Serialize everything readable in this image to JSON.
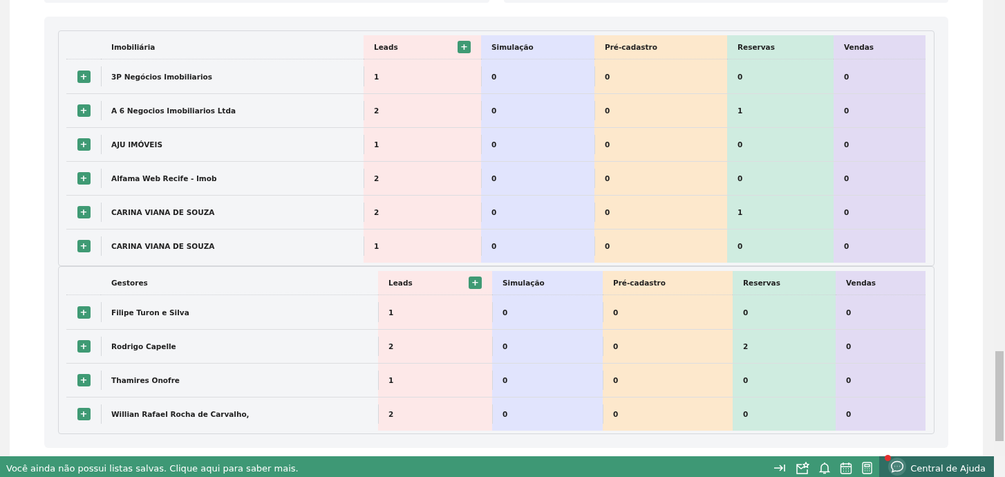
{
  "tables": [
    {
      "columns": [
        {
          "label": "Imobiliária"
        },
        {
          "label": "Leads",
          "color": "#fde8e8",
          "add_button": "+"
        },
        {
          "label": "Simulação",
          "color": "#e1e4fd"
        },
        {
          "label": "Pré-cadastro",
          "color": "#fde8cc"
        },
        {
          "label": "Reservas",
          "color": "#cfece0"
        },
        {
          "label": "Vendas",
          "color": "#e2dbf3"
        }
      ],
      "rows": [
        {
          "expand": "+",
          "name": "3P Negócios Imobiliarios",
          "values": [
            "1",
            "0",
            "0",
            "0",
            "0"
          ]
        },
        {
          "expand": "+",
          "name": "A 6 Negocios Imobiliarios Ltda",
          "values": [
            "2",
            "0",
            "0",
            "1",
            "0"
          ]
        },
        {
          "expand": "+",
          "name": "AJU IMÓVEIS",
          "values": [
            "1",
            "0",
            "0",
            "0",
            "0"
          ]
        },
        {
          "expand": "+",
          "name": "Alfama Web Recife - Imob",
          "values": [
            "2",
            "0",
            "0",
            "0",
            "0"
          ]
        },
        {
          "expand": "+",
          "name": "CARINA VIANA DE SOUZA",
          "values": [
            "2",
            "0",
            "0",
            "1",
            "0"
          ]
        },
        {
          "expand": "+",
          "name": "CARINA VIANA DE SOUZA",
          "values": [
            "1",
            "0",
            "0",
            "0",
            "0"
          ]
        }
      ]
    },
    {
      "columns": [
        {
          "label": "Gestores"
        },
        {
          "label": "Leads",
          "color": "#fde8e8",
          "add_button": "+"
        },
        {
          "label": "Simulação",
          "color": "#e1e4fd"
        },
        {
          "label": "Pré-cadastro",
          "color": "#fde8cc"
        },
        {
          "label": "Reservas",
          "color": "#cfece0"
        },
        {
          "label": "Vendas",
          "color": "#e2dbf3"
        }
      ],
      "rows": [
        {
          "expand": "+",
          "name": "Filipe Turon e Silva",
          "values": [
            "1",
            "0",
            "0",
            "0",
            "0"
          ]
        },
        {
          "expand": "+",
          "name": "Rodrigo Capelle",
          "values": [
            "2",
            "0",
            "0",
            "2",
            "0"
          ]
        },
        {
          "expand": "+",
          "name": "Thamires Onofre",
          "values": [
            "1",
            "0",
            "0",
            "0",
            "0"
          ]
        },
        {
          "expand": "+",
          "name": "Willian Rafael Rocha de Carvalho,",
          "values": [
            "2",
            "0",
            "0",
            "0",
            "0"
          ]
        }
      ]
    }
  ],
  "bottom_bar": {
    "message": "Você ainda não possui listas salvas. Clique aqui para saber mais.",
    "help": "Central de Ajuda"
  }
}
